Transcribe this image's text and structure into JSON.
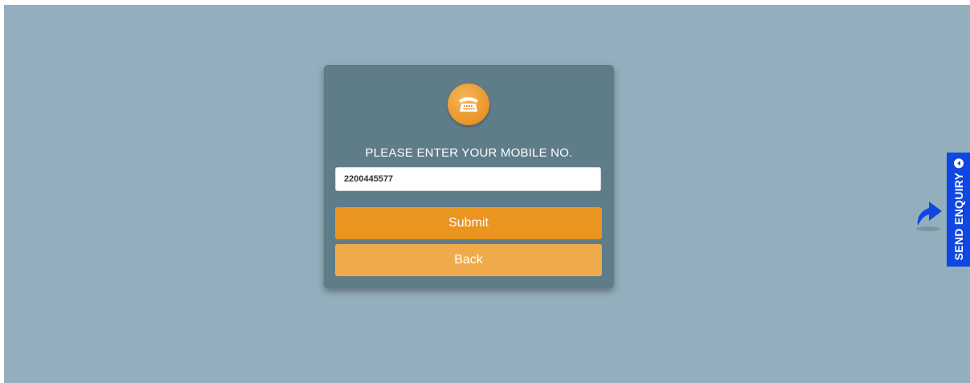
{
  "form": {
    "prompt": "PLEASE ENTER YOUR MOBILE NO.",
    "mobile_value": "2200445577",
    "submit_label": "Submit",
    "back_label": "Back",
    "icon": "phone-icon"
  },
  "enquiry": {
    "label": "SEND ENQUIRY",
    "icon": "curved-arrow-icon"
  },
  "colors": {
    "background": "#93afbd",
    "card": "#5f7c89",
    "submit": "#ea9520",
    "back": "#efab4a",
    "enquiry_tab": "#1046e2"
  }
}
